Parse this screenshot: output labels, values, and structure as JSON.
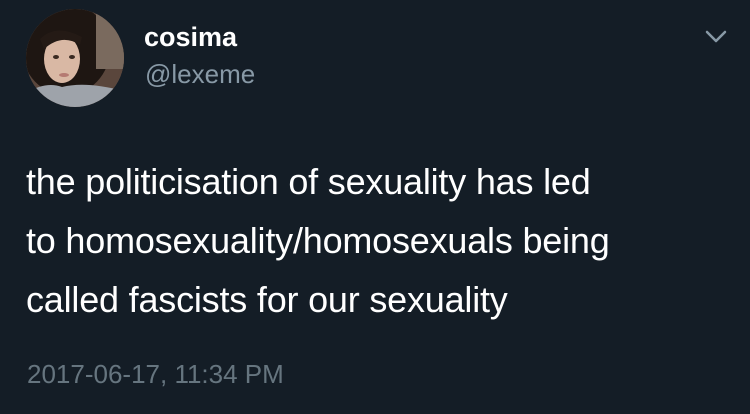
{
  "tweet": {
    "display_name": "cosima",
    "handle": "@lexeme",
    "text_lines": [
      "the politicisation of sexuality has led",
      "to homosexuality/homosexuals being",
      "called fascists for our sexuality"
    ],
    "timestamp": "2017-06-17, 11:34 PM"
  },
  "icons": {
    "menu": "chevron-down-icon"
  },
  "colors": {
    "background": "#141d26",
    "primary_text": "#ffffff",
    "secondary_text": "#8899a6",
    "timestamp_text": "#66757f"
  }
}
